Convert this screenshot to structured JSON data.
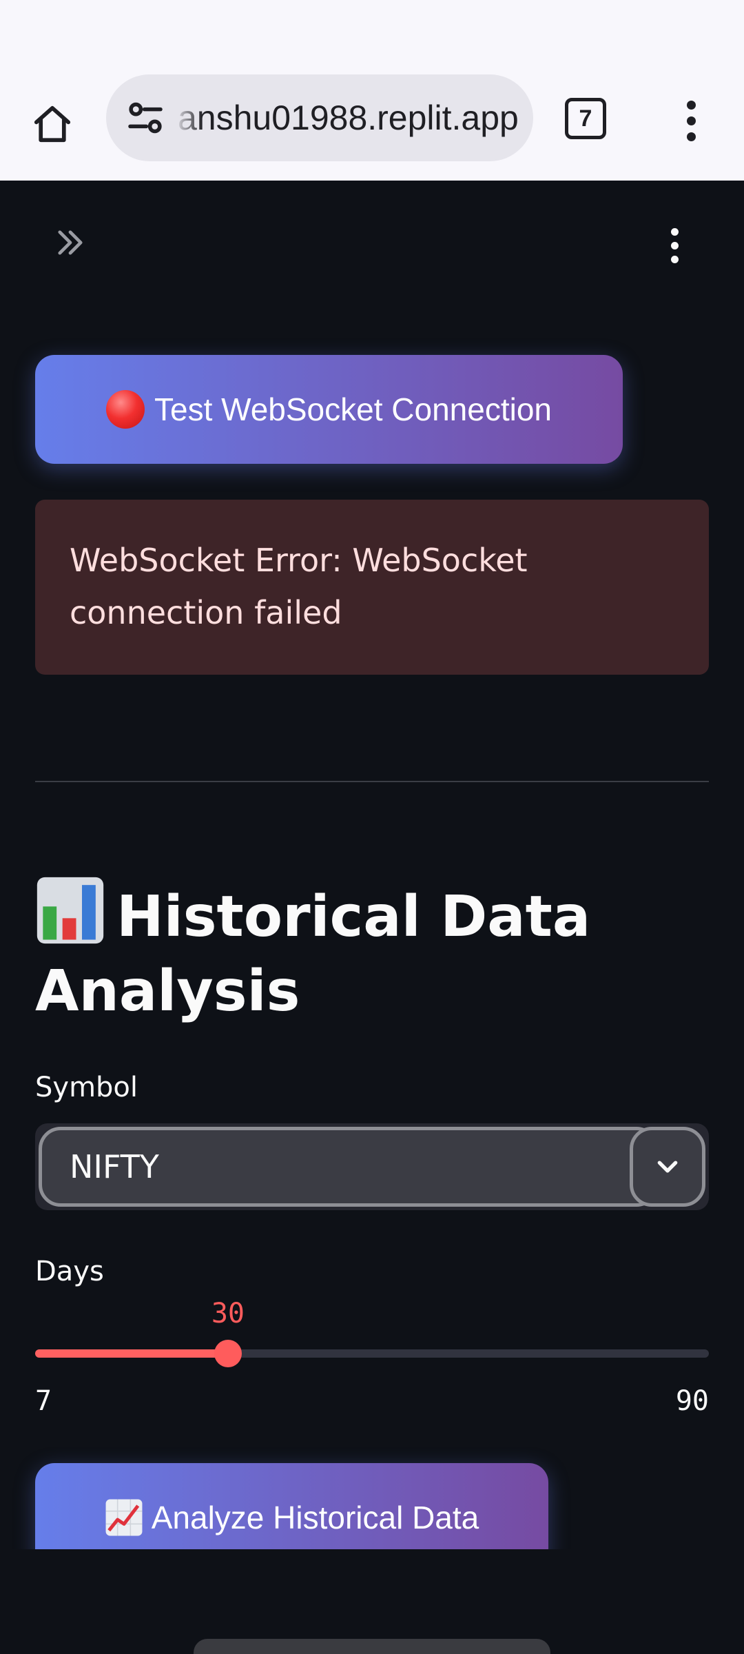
{
  "browser": {
    "url": "anshu01988.replit.app",
    "tab_count": "7"
  },
  "main": {
    "websocket_button_label": "Test WebSocket Connection",
    "error_message": "WebSocket Error: WebSocket connection failed",
    "section_title": "Historical Data Analysis",
    "symbol_label": "Symbol",
    "symbol_value": "NIFTY",
    "days_label": "Days",
    "days_value": 30,
    "days_min": 7,
    "days_max": 90,
    "analyze_button_label": "Analyze Historical Data"
  },
  "icons": {
    "home": "home-icon",
    "site_settings": "tune-icon",
    "browser_menu": "more-vert-icon",
    "sidebar_toggle": "double-chevron-right-icon",
    "app_menu": "more-vert-icon",
    "websocket": "red-circle-emoji",
    "section": "bar-chart-emoji",
    "analyze": "chart-increasing-emoji",
    "dropdown": "chevron-down-icon"
  },
  "colors": {
    "app_background": "#0e1117",
    "button_gradient_start": "#667eea",
    "button_gradient_end": "#764ba2",
    "error_background": "#3e2428",
    "slider_accent": "#ff5c5c"
  }
}
